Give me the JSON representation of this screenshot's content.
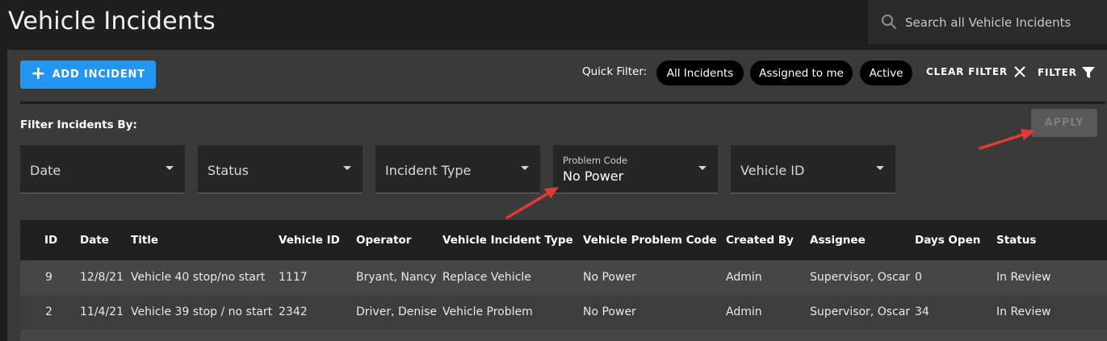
{
  "header": {
    "title": "Vehicle Incidents",
    "search_placeholder": "Search all Vehicle Incidents",
    "search_icon": "search-icon"
  },
  "toolbar": {
    "add_label": "ADD INCIDENT",
    "quick_filter_label": "Quick Filter:",
    "chips": [
      "All Incidents",
      "Assigned to me",
      "Active"
    ],
    "clear_filter_label": "CLEAR FILTER",
    "filter_label": "FILTER"
  },
  "filters": {
    "heading": "Filter Incidents By:",
    "apply_label": "APPLY",
    "date": "Date",
    "status": "Status",
    "incident_type": "Incident Type",
    "problem_code_label": "Problem Code",
    "problem_code_value": "No Power",
    "vehicle_id": "Vehicle ID"
  },
  "table": {
    "columns": [
      "ID",
      "Date",
      "Title",
      "Vehicle ID",
      "Operator",
      "Vehicle Incident Type",
      "Vehicle Problem Code",
      "Created By",
      "Assignee",
      "Days Open",
      "Status"
    ],
    "rows": [
      [
        "9",
        "12/8/21",
        "Vehicle 40 stop/no start",
        "1117",
        "Bryant, Nancy",
        "Replace Vehicle",
        "No Power",
        "Admin",
        "Supervisor, Oscar",
        "0",
        "In Review"
      ],
      [
        "2",
        "11/4/21",
        "Vehicle 39 stop / no start",
        "2342",
        "Driver, Denise",
        "Vehicle Problem",
        "No Power",
        "Admin",
        "Supervisor, Oscar",
        "34",
        "In Review"
      ]
    ]
  },
  "colors": {
    "accent": "#2196f3",
    "annotation_arrow": "#e53935"
  }
}
